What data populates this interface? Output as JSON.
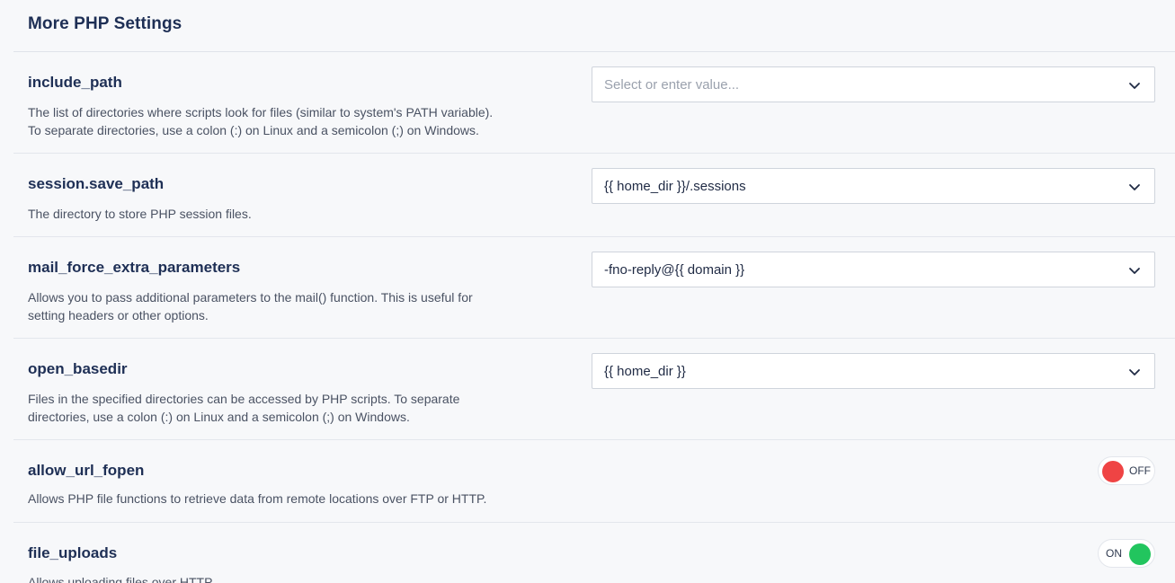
{
  "section": {
    "title": "More PHP Settings"
  },
  "settings": [
    {
      "name": "include_path",
      "desc_lines": [
        "The list of directories where scripts look for files (similar to system's PATH variable).",
        "To separate directories, use a colon (:) on Linux and a semicolon (;) on Windows."
      ],
      "control": "select",
      "value": "",
      "placeholder": "Select or enter value..."
    },
    {
      "name": "session.save_path",
      "desc_lines": [
        "The directory to store PHP session files."
      ],
      "control": "select",
      "value": "{{ home_dir }}/.sessions"
    },
    {
      "name": "mail_force_extra_parameters",
      "desc_lines": [
        "Allows you to pass additional parameters to the mail() function. This is useful for",
        "setting headers or other options."
      ],
      "control": "select",
      "value": "-fno-reply@{{ domain }}"
    },
    {
      "name": "open_basedir",
      "desc_lines": [
        "Files in the specified directories can be accessed by PHP scripts. To separate",
        "directories, use a colon (:) on Linux and a semicolon (;) on Windows."
      ],
      "control": "select",
      "value": "{{ home_dir }}"
    },
    {
      "name": "allow_url_fopen",
      "desc_lines": [
        "Allows PHP file functions to retrieve data from remote locations over FTP or HTTP."
      ],
      "control": "toggle",
      "state_label": "OFF",
      "on": false
    },
    {
      "name": "file_uploads",
      "desc_lines": [
        "Allows uploading files over HTTP."
      ],
      "control": "toggle",
      "state_label": "ON",
      "on": true
    }
  ],
  "colors": {
    "toggle_off": "#ef4444",
    "toggle_on": "#22c55e",
    "heading": "#1e2f55"
  },
  "icons": {
    "select_arrow": "chevron-down-icon"
  }
}
